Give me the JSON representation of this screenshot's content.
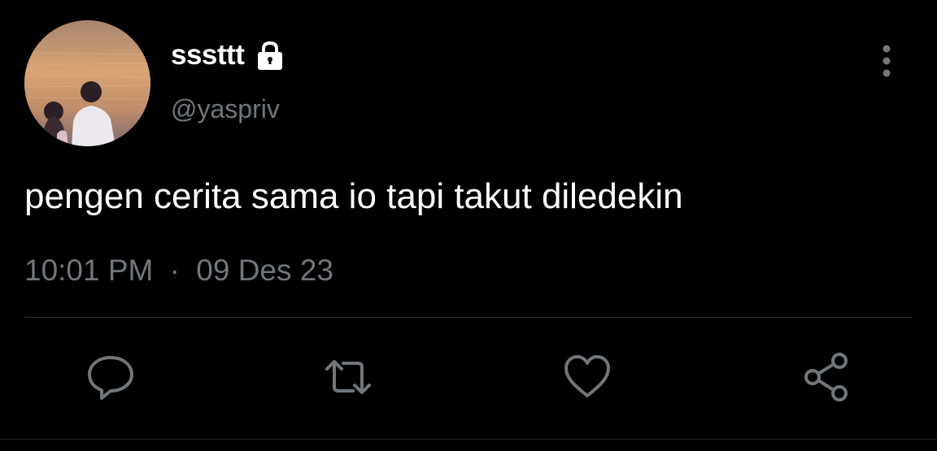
{
  "tweet": {
    "display_name": "sssttt",
    "handle": "@yaspriv",
    "text": "pengen cerita sama io tapi takut diledekin",
    "time": "10:01 PM",
    "separator": "·",
    "date": "09 Des 23"
  },
  "icons": {
    "lock": "lock-icon",
    "more": "more-vertical-icon",
    "reply": "reply-icon",
    "retweet": "retweet-icon",
    "like": "heart-icon",
    "share": "share-icon"
  },
  "colors": {
    "background": "#000000",
    "text_primary": "#ffffff",
    "text_secondary": "#71767b",
    "divider": "#2f3336",
    "icon": "#71767b"
  }
}
